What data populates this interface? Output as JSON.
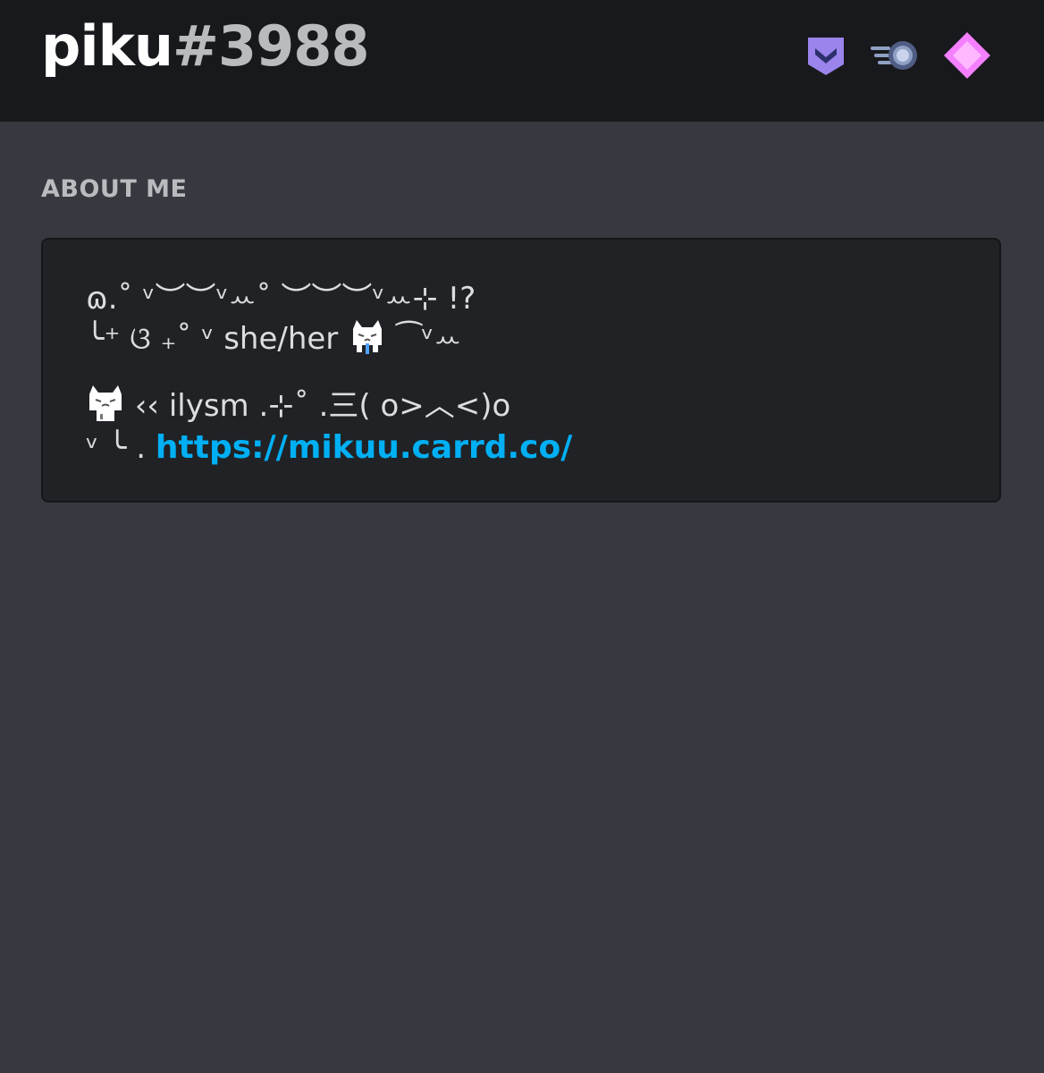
{
  "profile": {
    "username": "piku",
    "discriminator": "#3988"
  },
  "badges": [
    {
      "icon": "hypesquad-badge-icon",
      "color": "#9b84ec"
    },
    {
      "icon": "nitro-boost-badge-icon",
      "color": "#8fa0c4"
    },
    {
      "icon": "nitro-gem-badge-icon",
      "color": "#f47fff"
    }
  ],
  "about": {
    "title": "ABOUT ME",
    "line1": "ɷ.˚ ᵛ︶︶ᵛꕀ˚ ︶︶︶ᵛꕀ⊹ !?",
    "line2_a": "╰⁺ ଓ ₊˚ ᵛ she/her",
    "line2_b": " ⁀ᵛꕀ",
    "line3_b": " ‹‹ ilysm .⊹˚ .三( o>︿<)o",
    "line4_a": "ᵛ ╰ . ",
    "link": "https://mikuu.carrd.co/"
  },
  "colors": {
    "background": "#36393f",
    "header": "#18191c",
    "box": "#202225",
    "link": "#00aff4",
    "text": "#dcddde"
  }
}
